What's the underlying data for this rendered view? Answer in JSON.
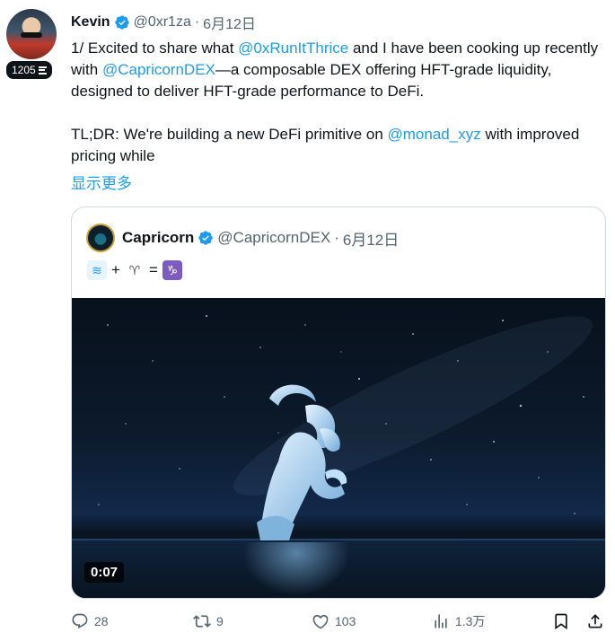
{
  "author": {
    "name": "Kevin",
    "handle": "@0xr1za",
    "date": "6月12日",
    "badge_count": "1205"
  },
  "tweet": {
    "line1_pre": "1/ Excited to share what ",
    "mention1": "@0xRunItThrice",
    "line1_post": " and I have been cooking up recently with ",
    "mention2": "@CapricornDEX",
    "line1_tail": "—a composable DEX offering HFT-grade liquidity, designed to deliver HFT-grade performance to DeFi.",
    "line2_pre": "TL;DR: We're building a new DeFi primitive on ",
    "mention3": "@monad_xyz",
    "line2_post": " with improved pricing while",
    "show_more": "显示更多"
  },
  "quote": {
    "name": "Capricorn",
    "handle": "@CapricornDEX",
    "date": "6月12日",
    "emoji_plus": "+",
    "emoji_eq": "=",
    "video_time": "0:07"
  },
  "actions": {
    "replies": "28",
    "retweets": "9",
    "likes": "103",
    "views": "1.3万"
  },
  "colors": {
    "link": "#1d9bf0",
    "secondary_text": "#536471",
    "border": "#cfd9de"
  },
  "icons": [
    "verified-badge-icon",
    "reply-icon",
    "retweet-icon",
    "like-icon",
    "views-icon",
    "bookmark-icon",
    "share-icon"
  ]
}
